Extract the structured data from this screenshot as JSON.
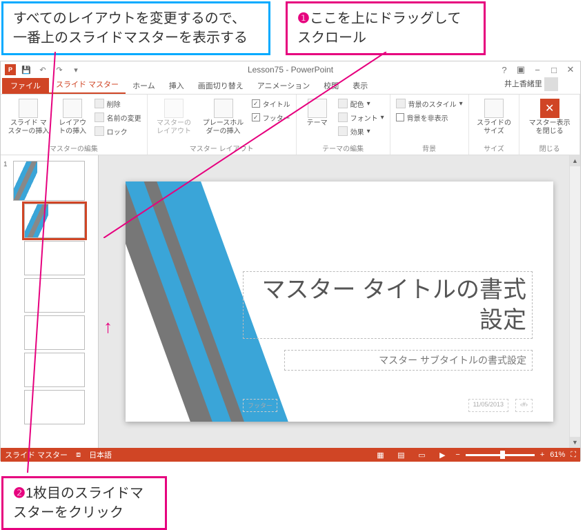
{
  "callouts": {
    "top_blue": "すべてのレイアウトを変更するので、\n一番上のスライドマスターを表示する",
    "top_pink_num": "❶",
    "top_pink": "ここを上にドラッグしてスクロール",
    "bottom_pink_num": "❷",
    "bottom_pink": "1枚目のスライドマスターをクリック"
  },
  "title": "Lesson75 - PowerPoint",
  "account": "井上香緒里",
  "tabs": {
    "file": "ファイル",
    "slide_master": "スライド マスター",
    "home": "ホーム",
    "insert": "挿入",
    "transitions": "画面切り替え",
    "animations": "アニメーション",
    "review": "校閲",
    "view": "表示"
  },
  "ribbon": {
    "g1": {
      "insert_master": "スライド マスターの挿入",
      "insert_layout": "レイアウトの挿入",
      "delete": "削除",
      "rename": "名前の変更",
      "lock": "ロック",
      "label": "マスターの編集"
    },
    "g2": {
      "master_layout": "マスターのレイアウト",
      "insert_placeholder": "プレースホルダーの挿入",
      "title_chk": "タイトル",
      "footer_chk": "フッター",
      "label": "マスター レイアウト"
    },
    "g3": {
      "themes": "テーマ",
      "colors": "配色",
      "fonts": "フォント",
      "effects": "効果",
      "label": "テーマの編集"
    },
    "g4": {
      "bg_style": "背景のスタイル",
      "hide_bg": "背景を非表示",
      "label": "背景"
    },
    "g5": {
      "slide_size": "スライドのサイズ",
      "label": "サイズ"
    },
    "g6": {
      "close": "マスター表示を閉じる",
      "label": "閉じる"
    }
  },
  "slide": {
    "title": "マスター タイトルの書式設定",
    "subtitle": "マスター サブタイトルの書式設定",
    "footer": "フッター",
    "date": "11/05/2013",
    "num": "‹#›"
  },
  "thumbs": {
    "first_num": "1"
  },
  "status": {
    "view_label": "スライド マスター",
    "lang": "日本語",
    "zoom": "61%"
  }
}
